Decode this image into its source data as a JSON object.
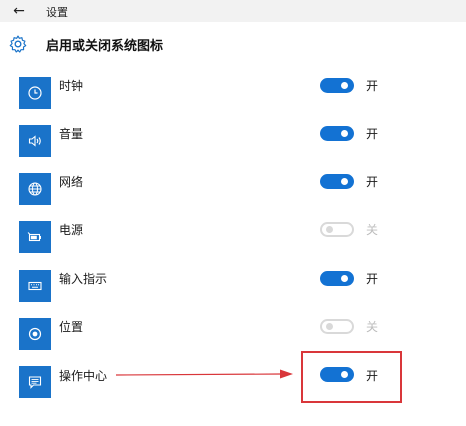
{
  "app": {
    "back_icon": "back-arrow-icon",
    "title": "设置"
  },
  "page": {
    "icon": "gear-icon",
    "title": "启用或关闭系统图标"
  },
  "items": [
    {
      "label": "时钟",
      "icon": "clock-icon",
      "state": "开",
      "on": true
    },
    {
      "label": "音量",
      "icon": "volume-icon",
      "state": "开",
      "on": true
    },
    {
      "label": "网络",
      "icon": "network-icon",
      "state": "开",
      "on": true
    },
    {
      "label": "电源",
      "icon": "battery-icon",
      "state": "关",
      "on": false
    },
    {
      "label": "输入指示",
      "icon": "keyboard-icon",
      "state": "开",
      "on": true
    },
    {
      "label": "位置",
      "icon": "location-icon",
      "state": "关",
      "on": false
    },
    {
      "label": "操作中心",
      "icon": "action-center-icon",
      "state": "开",
      "on": true
    }
  ],
  "colors": {
    "accent": "#1372d3",
    "tile": "#1a73c9",
    "annotation": "#d9363a"
  }
}
